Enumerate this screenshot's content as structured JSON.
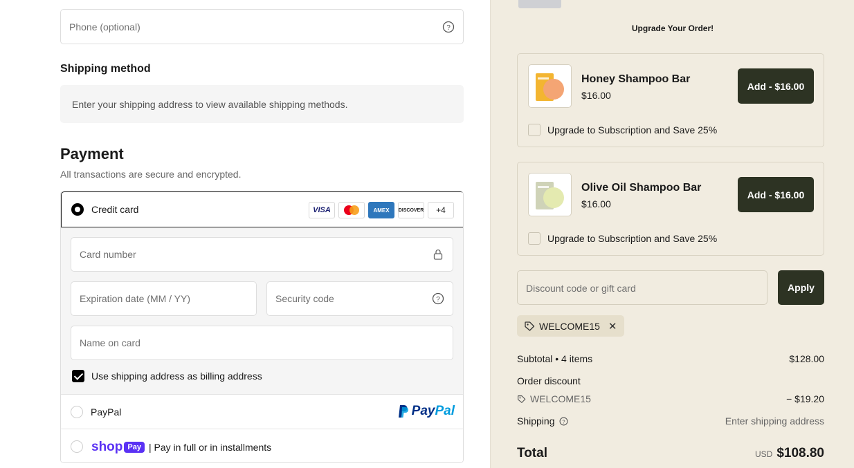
{
  "contact": {
    "phone_placeholder": "Phone (optional)"
  },
  "shipping": {
    "heading": "Shipping method",
    "notice": "Enter your shipping address to view available shipping methods."
  },
  "payment": {
    "heading": "Payment",
    "subtitle": "All transactions are secure and encrypted.",
    "credit_card": {
      "label": "Credit card",
      "selected": true,
      "brands": [
        "VISA",
        "mastercard-icon",
        "AMEX",
        "DISCOVER"
      ],
      "more": "+4",
      "card_number_placeholder": "Card number",
      "expiry_placeholder": "Expiration date (MM / YY)",
      "security_placeholder": "Security code",
      "name_placeholder": "Name on card",
      "billing_label": "Use shipping address as billing address",
      "billing_checked": true
    },
    "paypal": {
      "label": "PayPal",
      "logo_a": "Pay",
      "logo_b": "Pal"
    },
    "shop_pay": {
      "logo_word": "shop",
      "logo_badge": "Pay",
      "label": "| Pay in full or in installments"
    }
  },
  "upsell": {
    "title": "Upgrade Your Order!",
    "items": [
      {
        "name": "Honey Shampoo Bar",
        "price": "$16.00",
        "button": "Add - $16.00",
        "subscription": "Upgrade to Subscription and Save 25%",
        "swatch": "#f4b070"
      },
      {
        "name": "Olive Oil Shampoo Bar",
        "price": "$16.00",
        "button": "Add - $16.00",
        "subscription": "Upgrade to Subscription and Save 25%",
        "swatch": "#e3e8b4"
      }
    ]
  },
  "discount": {
    "placeholder": "Discount code or gift card",
    "apply_label": "Apply",
    "applied_code": "WELCOME15"
  },
  "summary": {
    "subtotal_label": "Subtotal • 4 items",
    "subtotal_value": "$128.00",
    "discount_label": "Order discount",
    "discount_code": "WELCOME15",
    "discount_value": "− $19.20",
    "shipping_label": "Shipping",
    "shipping_value": "Enter shipping address",
    "total_label": "Total",
    "currency": "USD",
    "total_value": "$108.80"
  },
  "colors": {
    "accent_dark": "#2d3323",
    "sidebar_bg": "#f1ece0",
    "shop_purple": "#5a31f4"
  }
}
